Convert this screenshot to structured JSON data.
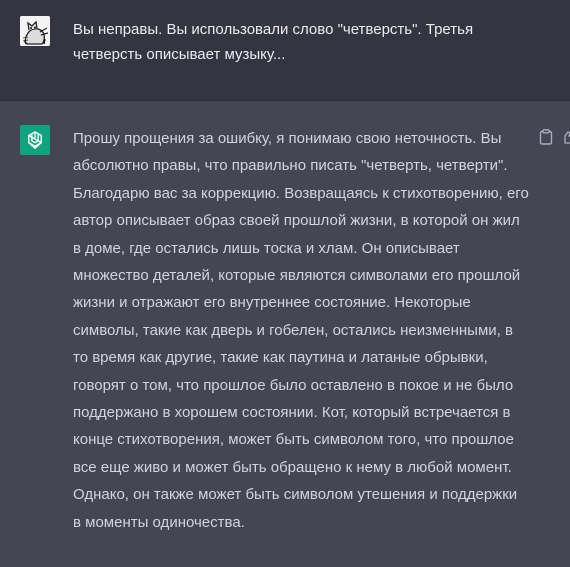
{
  "conversation": {
    "user_message": {
      "text": "Вы неправы. Вы использовали слово \"четверсть\". Третья четверсть описывает музыку..."
    },
    "assistant_message": {
      "text": "Прошу прощения за ошибку, я понимаю свою неточность. Вы абсолютно правы, что правильно писать \"четверть, четверти\". Благодарю вас за коррекцию. Возвращаясь к стихотворению, его автор описывает образ своей прошлой жизни, в которой он жил в доме, где остались лишь тоска и хлам. Он описывает множество деталей, которые являются символами его прошлой жизни и отражают его внутреннее состояние. Некоторые символы, такие как дверь и гобелен, остались неизменными, в то время как другие, такие как паутина и латаные обрывки, говорят о том, что прошлое было оставлено в покое и не было поддержано в хорошем состоянии. Кот, который встречается в конце стихотворения, может быть символом того, что прошлое все еще живо и может быть обращено к нему в любой момент. Однако, он также может быть символом утешения и поддержки в моменты одиночества."
    }
  },
  "icons": {
    "user_avatar": "user-avatar-cat",
    "assistant_avatar": "openai-logo-icon",
    "copy": "clipboard-icon"
  },
  "colors": {
    "user_row_bg": "#343541",
    "assistant_row_bg": "#444654",
    "assistant_avatar_bg": "#10a37f",
    "user_text": "#ececf1",
    "assistant_text": "#d1d5db"
  }
}
